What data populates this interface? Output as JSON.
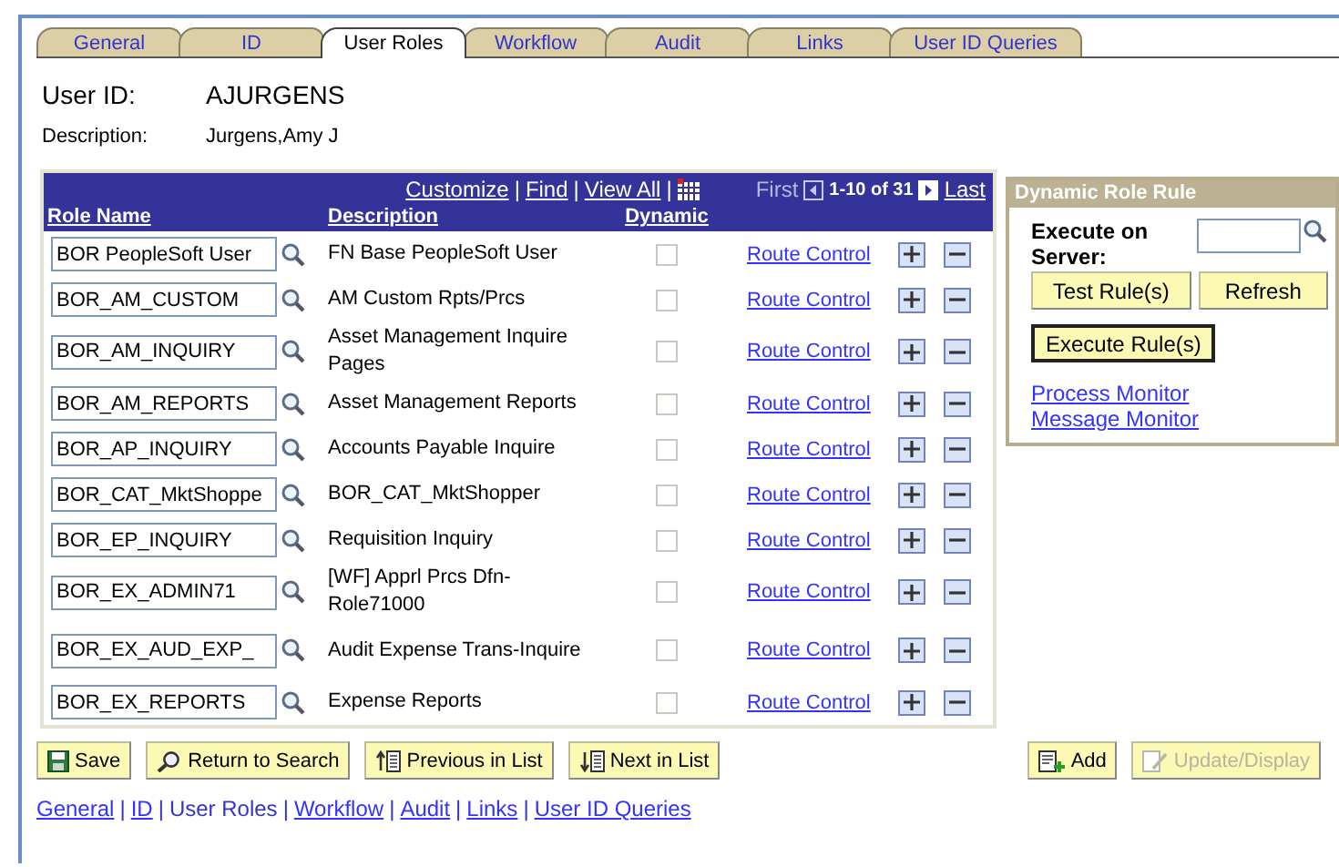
{
  "tabs": [
    {
      "label": "General",
      "selected": false
    },
    {
      "label": "ID",
      "selected": false
    },
    {
      "label": "User Roles",
      "selected": true
    },
    {
      "label": "Workflow",
      "selected": false
    },
    {
      "label": "Audit",
      "selected": false
    },
    {
      "label": "Links",
      "selected": false
    },
    {
      "label": "User ID Queries",
      "selected": false
    }
  ],
  "user_id": {
    "label": "User ID:",
    "value": "AJURGENS"
  },
  "description": {
    "label": "Description:",
    "value": "Jurgens,Amy J"
  },
  "grid": {
    "nav_links": [
      "Customize",
      "Find",
      "View All"
    ],
    "separator": "|",
    "first": "First",
    "first_disabled": true,
    "range": "1-10 of 31",
    "last": "Last",
    "columns": [
      "Role Name",
      "Description",
      "Dynamic"
    ],
    "rows": [
      {
        "role_name": "BOR PeopleSoft User",
        "description": "FN Base PeopleSoft User",
        "dynamic_checked": false,
        "dynamic_disabled": true,
        "link": "Route Control"
      },
      {
        "role_name": "BOR_AM_CUSTOM",
        "description": "AM Custom Rpts/Prcs",
        "dynamic_checked": false,
        "dynamic_disabled": true,
        "link": "Route Control"
      },
      {
        "role_name": "BOR_AM_INQUIRY",
        "description": "Asset Management Inquire Pages",
        "dynamic_checked": false,
        "dynamic_disabled": true,
        "link": "Route Control"
      },
      {
        "role_name": "BOR_AM_REPORTS",
        "description": "Asset Management Reports",
        "dynamic_checked": false,
        "dynamic_disabled": true,
        "link": "Route Control"
      },
      {
        "role_name": "BOR_AP_INQUIRY",
        "description": "Accounts Payable Inquire",
        "dynamic_checked": false,
        "dynamic_disabled": true,
        "link": "Route Control"
      },
      {
        "role_name": "BOR_CAT_MktShoppe",
        "description": "BOR_CAT_MktShopper",
        "dynamic_checked": false,
        "dynamic_disabled": true,
        "link": "Route Control"
      },
      {
        "role_name": "BOR_EP_INQUIRY",
        "description": "Requisition Inquiry",
        "dynamic_checked": false,
        "dynamic_disabled": true,
        "link": "Route Control"
      },
      {
        "role_name": "BOR_EX_ADMIN71",
        "description": "[WF] Apprl Prcs Dfn-Role71000",
        "dynamic_checked": false,
        "dynamic_disabled": true,
        "link": "Route Control"
      },
      {
        "role_name": "BOR_EX_AUD_EXP_",
        "description": "Audit Expense Trans-Inquire",
        "dynamic_checked": false,
        "dynamic_disabled": true,
        "link": "Route Control"
      },
      {
        "role_name": "BOR_EX_REPORTS",
        "description": "Expense Reports",
        "dynamic_checked": false,
        "dynamic_disabled": true,
        "link": "Route Control"
      }
    ]
  },
  "rule_panel": {
    "title": "Dynamic Role Rule",
    "execute_label": "Execute on Server:",
    "buttons": [
      {
        "label": "Test Rule(s)",
        "focused": false
      },
      {
        "label": "Refresh",
        "focused": false
      },
      {
        "label": "Execute Rule(s)",
        "focused": true
      }
    ],
    "links": [
      "Process Monitor",
      "Message Monitor"
    ]
  },
  "toolbar": {
    "left": [
      {
        "label": "Save",
        "kind": "save",
        "disabled": false
      },
      {
        "label": "Return to Search",
        "kind": "search",
        "disabled": false
      },
      {
        "label": "Previous in List",
        "kind": "previous",
        "disabled": false
      },
      {
        "label": "Next in List",
        "kind": "next",
        "disabled": false
      }
    ],
    "right": [
      {
        "label": "Add",
        "kind": "add",
        "disabled": false
      },
      {
        "label": "Update/Display",
        "kind": "update",
        "disabled": true
      }
    ]
  },
  "footer_links": {
    "separator": "|",
    "items": [
      {
        "label": "General",
        "selected": false
      },
      {
        "label": "ID",
        "selected": false
      },
      {
        "label": "User Roles",
        "selected": true
      },
      {
        "label": "Workflow",
        "selected": false
      },
      {
        "label": "Audit",
        "selected": false
      },
      {
        "label": "Links",
        "selected": false
      },
      {
        "label": "User ID Queries",
        "selected": false
      }
    ]
  }
}
